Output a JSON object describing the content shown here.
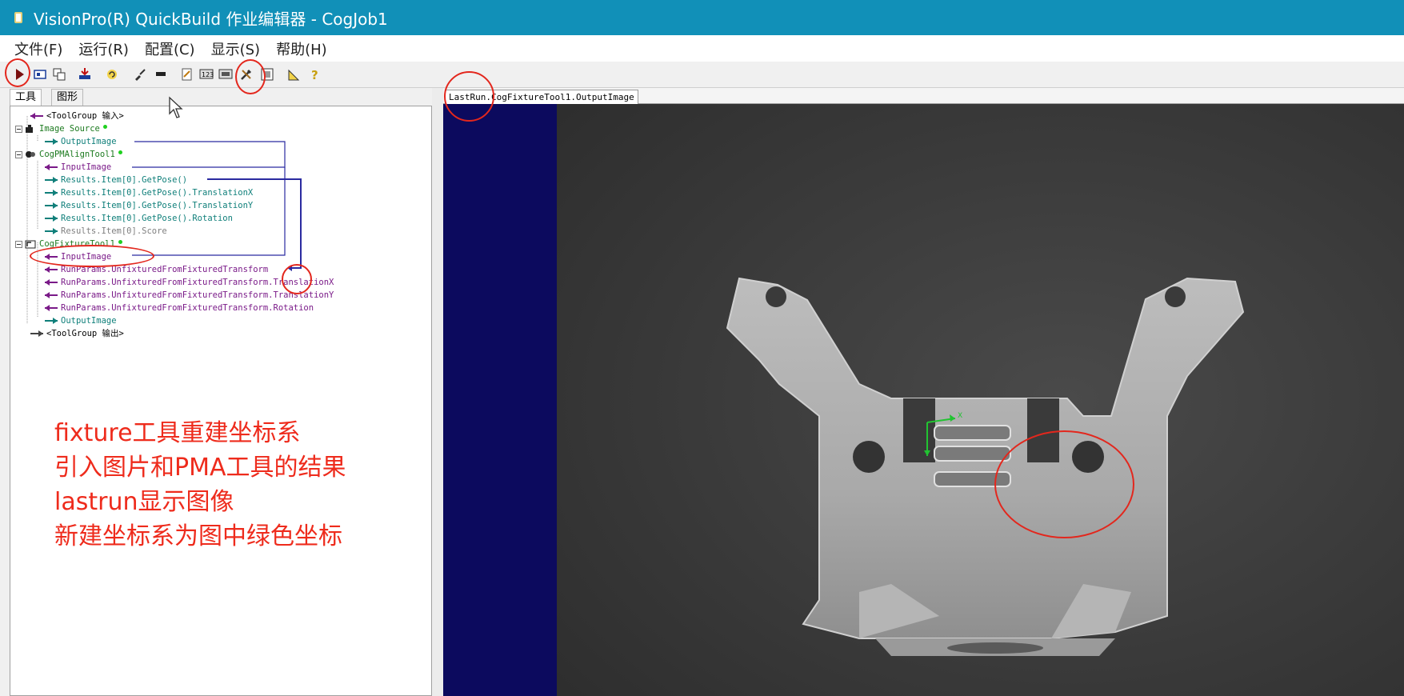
{
  "window": {
    "title": "VisionPro(R) QuickBuild 作业编辑器 - CogJob1"
  },
  "menu": [
    "文件(F)",
    "运行(R)",
    "配置(C)",
    "显示(S)",
    "帮助(H)"
  ],
  "toolbar": {
    "buttons": [
      "run-icon",
      "image-icon",
      "window-icon",
      "import-icon",
      "refresh-icon",
      "brush-icon",
      "marker-icon",
      "edit-icon",
      "grid-icon",
      "display-icon",
      "tools-icon",
      "panel-icon",
      "ruler-icon",
      "help-icon"
    ]
  },
  "tabs": {
    "tools": "工具",
    "graphics": "图形"
  },
  "tree": [
    {
      "label": "<ToolGroup 输入>",
      "dir": "in",
      "color": "black"
    },
    {
      "label": "Image Source",
      "color": "green",
      "node": true
    },
    {
      "label": "OutputImage",
      "dir": "out",
      "color": "teal"
    },
    {
      "label": "CogPMAlignTool1",
      "color": "green",
      "node": true
    },
    {
      "label": "InputImage",
      "dir": "in",
      "color": "purple"
    },
    {
      "label": "Results.Item[0].GetPose()",
      "dir": "out",
      "color": "teal"
    },
    {
      "label": "Results.Item[0].GetPose().TranslationX",
      "dir": "out",
      "color": "teal"
    },
    {
      "label": "Results.Item[0].GetPose().TranslationY",
      "dir": "out",
      "color": "teal"
    },
    {
      "label": "Results.Item[0].GetPose().Rotation",
      "dir": "out",
      "color": "teal"
    },
    {
      "label": "Results.Item[0].Score",
      "dir": "out",
      "color": "grey"
    },
    {
      "label": "CogFixtureTool1",
      "color": "green",
      "node": true
    },
    {
      "label": "InputImage",
      "dir": "in",
      "color": "purple"
    },
    {
      "label": "RunParams.UnfixturedFromFixturedTransform",
      "dir": "in",
      "color": "purple"
    },
    {
      "label": "RunParams.UnfixturedFromFixturedTransform.TranslationX",
      "dir": "in",
      "color": "purple"
    },
    {
      "label": "RunParams.UnfixturedFromFixturedTransform.TranslationY",
      "dir": "in",
      "color": "purple"
    },
    {
      "label": "RunParams.UnfixturedFromFixturedTransform.Rotation",
      "dir": "in",
      "color": "purple"
    },
    {
      "label": "OutputImage",
      "dir": "out",
      "color": "teal"
    },
    {
      "label": "<ToolGroup 输出>",
      "dir": "out",
      "color": "black"
    }
  ],
  "annotations": [
    "fixture工具重建坐标系",
    "引入图片和PMA工具的结果",
    "lastrun显示图像",
    "新建坐标系为图中绿色坐标"
  ],
  "image_panel": {
    "tab_label": "LastRun.CogFixtureTool1.OutputImage"
  },
  "colors": {
    "titlebar": "#1190b8",
    "annotation_red": "#ee2b1c",
    "image_bg": "#0c0a5e"
  }
}
